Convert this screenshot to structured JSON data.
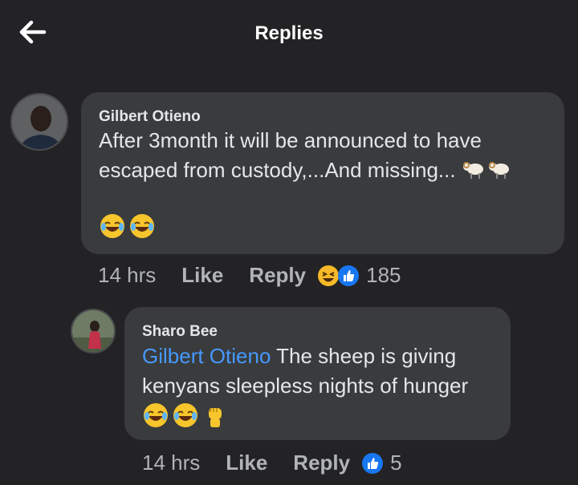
{
  "header": {
    "title": "Replies"
  },
  "comments": [
    {
      "author": "Gilbert Otieno",
      "text": "After 3month it will be announced to have escaped from custody,...And missing...",
      "text_emojis": [
        "ram-emoji",
        "ram-emoji"
      ],
      "bottom_emojis": [
        "joy-emoji",
        "joy-emoji"
      ],
      "time": "14 hrs",
      "like_label": "Like",
      "reply_label": "Reply",
      "reactions": [
        "haha-icon",
        "like-icon"
      ],
      "reaction_count": "185"
    },
    {
      "author": "Sharo Bee",
      "mention": "Gilbert Otieno",
      "text": " The sheep is giving kenyans sleepless nights of hunger",
      "bottom_emojis": [
        "joy-emoji",
        "joy-emoji",
        "raised-fist-emoji"
      ],
      "time": "14 hrs",
      "like_label": "Like",
      "reply_label": "Reply",
      "reactions": [
        "like-icon"
      ],
      "reaction_count": "5"
    }
  ],
  "colors": {
    "background": "#232325",
    "bubble": "#3a3b3c",
    "mention": "#4599ff",
    "like_blue": "#1877f2",
    "haha_yellow": "#f7b928"
  }
}
